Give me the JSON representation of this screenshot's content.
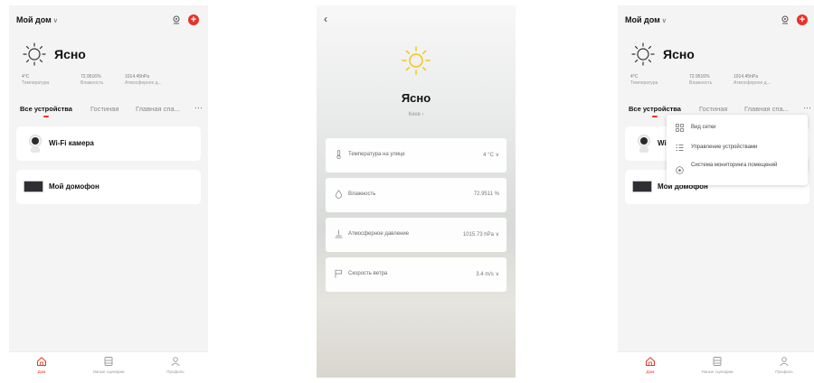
{
  "home": {
    "name": "Мой дом",
    "weather_title": "Ясно",
    "stats": [
      {
        "value": "4°C",
        "label": "Температура"
      },
      {
        "value": "72.9516%",
        "label": "Влажность"
      },
      {
        "value": "1014.45hPa",
        "label": "Атмосферное д..."
      }
    ],
    "tabs": [
      "Все устройства",
      "Гостиная",
      "Главная спа..."
    ],
    "more": "···",
    "devices": [
      {
        "name": "Wi-Fi камера",
        "icon": "camera-icon"
      },
      {
        "name": "Мой домофон",
        "icon": "intercom-icon"
      }
    ],
    "nav": [
      {
        "label": "Дом",
        "icon": "home-icon"
      },
      {
        "label": "Умные сценарии",
        "icon": "scenes-icon"
      },
      {
        "label": "Профиль",
        "icon": "profile-icon"
      }
    ]
  },
  "weather_detail": {
    "title": "Ясно",
    "city": "Киев",
    "city_chevron": "›",
    "rows": [
      {
        "label": "Температура на улице",
        "value": "4 °C",
        "icon": "thermometer-icon"
      },
      {
        "label": "Влажность",
        "value": "72.9511 %",
        "icon": "droplet-icon"
      },
      {
        "label": "Атмосферное давление",
        "value": "1015.73 hPa",
        "icon": "pressure-icon"
      },
      {
        "label": "Скорость ветра",
        "value": "3.4 m/s",
        "icon": "wind-icon"
      }
    ]
  },
  "menu": {
    "items": [
      {
        "label": "Вид сетки",
        "icon": "grid-icon"
      },
      {
        "label": "Управление устройствами",
        "icon": "list-icon"
      },
      {
        "label": "Система мониторинга помещений",
        "icon": "monitor-icon"
      }
    ]
  },
  "colors": {
    "accent": "#e8332a",
    "sun": "#f5c518"
  }
}
